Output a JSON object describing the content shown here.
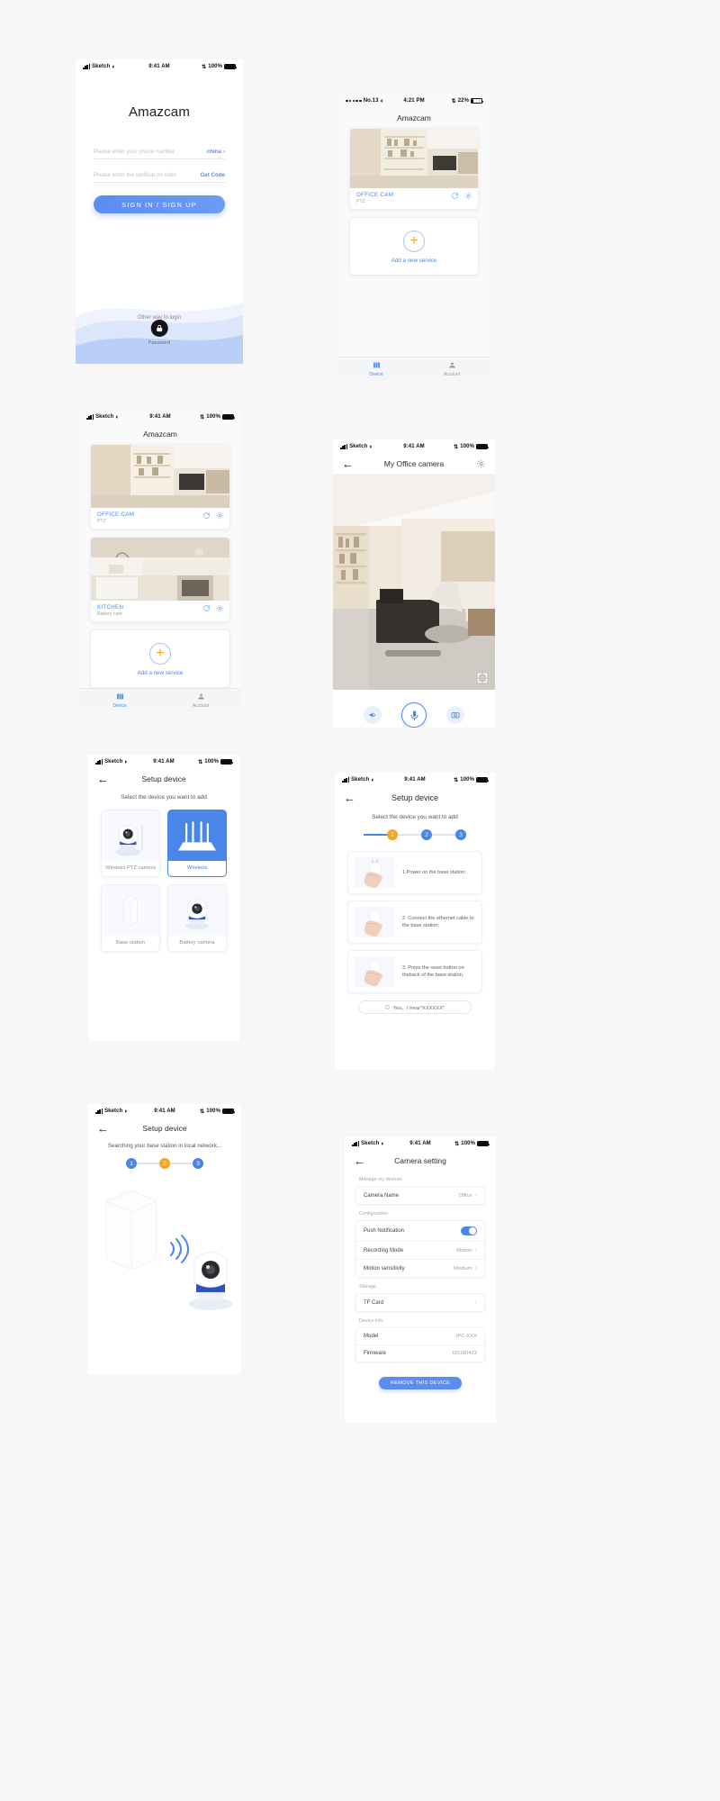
{
  "app": {
    "name": "Amazcam",
    "accent": "#4a86e8",
    "accent_orange": "#f5a623"
  },
  "screens": {
    "login": {
      "status": {
        "carrier": "Sketch",
        "time": "9:41 AM",
        "battery": "100%"
      },
      "title": "Amazcam",
      "phone_placeholder": "Please enter your phone number",
      "country": "china",
      "code_placeholder": "Please enter the verificat on code",
      "get_code": "Get Code",
      "submit": "SIGN IN / SIGN UP",
      "other_way": "Other way to login",
      "password_label": "Password",
      "lock_icon": "lock-icon"
    },
    "device_list_one": {
      "status": {
        "carrier": "No.13",
        "time": "4:21 PM",
        "battery": "22%"
      },
      "title": "Amazcam",
      "devices": [
        {
          "name": "OFFICE CAM",
          "type": "PTZ",
          "icons": [
            "refresh-icon",
            "gear-icon"
          ]
        }
      ],
      "add_label": "Add a new service",
      "tabs": [
        {
          "label": "Device",
          "icon": "device-icon",
          "active": true
        },
        {
          "label": "Account",
          "icon": "account-icon",
          "active": false
        }
      ]
    },
    "device_list_two": {
      "status": {
        "carrier": "Sketch",
        "time": "9:41 AM",
        "battery": "100%"
      },
      "title": "Amazcam",
      "devices": [
        {
          "name": "OFFICE CAM",
          "type": "PTZ",
          "icons": [
            "refresh-icon",
            "gear-icon"
          ]
        },
        {
          "name": "KITCHEN",
          "type": "Battery cam",
          "icons": [
            "refresh-icon",
            "gear-icon"
          ]
        }
      ],
      "add_label": "Add a new service",
      "tabs": [
        {
          "label": "Device",
          "icon": "device-icon",
          "active": true
        },
        {
          "label": "Account",
          "icon": "account-icon",
          "active": false
        }
      ]
    },
    "live_view": {
      "status": {
        "carrier": "Sketch",
        "time": "9:41 AM",
        "battery": "100%"
      },
      "title": "My Office camera",
      "back_icon": "back-arrow-icon",
      "gear_icon": "gear-icon",
      "fullscreen_icon": "fullscreen-icon",
      "controls": [
        {
          "name": "speaker-button",
          "icon": "speaker-icon"
        },
        {
          "name": "mic-button",
          "icon": "microphone-icon"
        },
        {
          "name": "snapshot-button",
          "icon": "camera-icon"
        }
      ]
    },
    "setup_select": {
      "status": {
        "carrier": "Sketch",
        "time": "9:41 AM",
        "battery": "100%"
      },
      "title": "Setup device",
      "subtitle": "Select the device you want to add",
      "devices": [
        {
          "label": "Wireless PTZ camera",
          "icon": "ptz-camera-icon",
          "selected": false
        },
        {
          "label": "Wireless",
          "icon": "router-icon",
          "selected": true
        },
        {
          "label": "Base station",
          "icon": "base-station-icon",
          "selected": false
        },
        {
          "label": "Battery camera",
          "icon": "battery-camera-icon",
          "selected": false
        }
      ]
    },
    "setup_steps": {
      "status": {
        "carrier": "Sketch",
        "time": "9:41 AM",
        "battery": "100%"
      },
      "title": "Setup device",
      "subtitle": "Select the device you want to add",
      "steps": [
        "1",
        "2",
        "3"
      ],
      "active_step": 1,
      "instructions": [
        "1.Power on the base station;",
        "2. Connect the ethernet cable to the base station;",
        "3. Press the reset button on theback of the base station."
      ],
      "confirm": "Yes，I hear\"XXXXXX\""
    },
    "setup_search": {
      "status": {
        "carrier": "Sketch",
        "time": "9:41 AM",
        "battery": "100%"
      },
      "title": "Setup device",
      "subtitle": "Searching your base station in local network...",
      "steps": [
        "1",
        "2",
        "3"
      ],
      "active_step": 2
    },
    "camera_setting": {
      "status": {
        "carrier": "Sketch",
        "time": "9:41 AM",
        "battery": "100%"
      },
      "title": "Camera setting",
      "back_icon": "back-arrow-icon",
      "groups": [
        {
          "title": "Manage my devices",
          "rows": [
            {
              "label": "Camera Name",
              "value": "Office",
              "control": "chevron"
            }
          ]
        },
        {
          "title": "Configuration",
          "rows": [
            {
              "label": "Push Notification",
              "value": "",
              "control": "toggle"
            },
            {
              "label": "Recording Mode",
              "value": "Motion",
              "control": "chevron"
            },
            {
              "label": "Motion sensitivity",
              "value": "Medium",
              "control": "chevron"
            }
          ]
        },
        {
          "title": "Storage",
          "rows": [
            {
              "label": "TF Card",
              "value": "",
              "control": "chevron"
            }
          ]
        },
        {
          "title": "Device info",
          "rows": [
            {
              "label": "Model",
              "value": "IPC-XXX",
              "control": "none"
            },
            {
              "label": "Firmware",
              "value": "f20180423",
              "control": "none"
            }
          ]
        }
      ],
      "remove_button": "REMOVE THIS DEVICE"
    }
  }
}
